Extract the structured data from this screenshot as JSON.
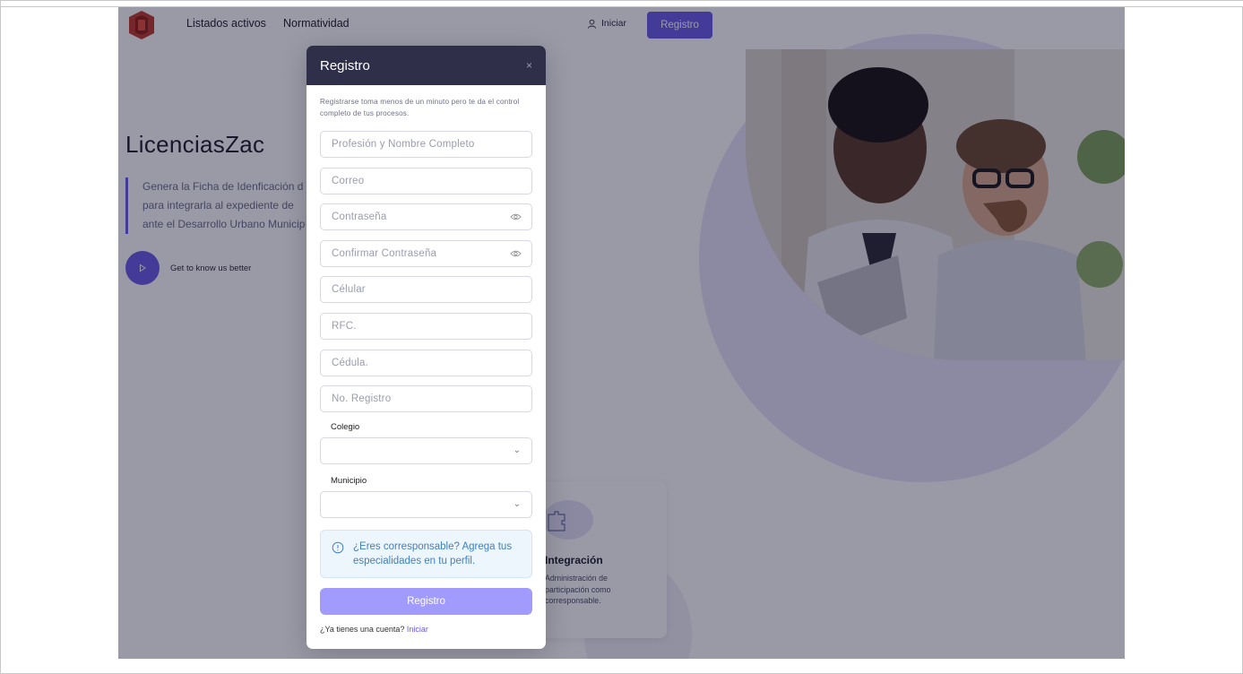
{
  "nav": {
    "links": [
      "Listados activos",
      "Normatividad"
    ],
    "login_label": "Iniciar",
    "register_label": "Registro",
    "accent": "#6c5ce7"
  },
  "hero": {
    "title": "LicenciasZac",
    "quote_lines": [
      "Genera la Ficha de Idenficación d",
      "para integrarla al expediente de",
      "ante el Desarrollo Urbano Municip"
    ],
    "play_label": "Get to know us better"
  },
  "card": {
    "title": "Integración",
    "text": "Administración de participación como corresponsable."
  },
  "modal": {
    "title": "Registro",
    "close": "×",
    "intro": "Registrarse toma menos de un minuto pero te da el control completo de tus procesos.",
    "fields": {
      "name": "Profesión y Nombre Completo",
      "email": "Correo",
      "password": "Contraseña",
      "confirm_password": "Confirmar Contraseña",
      "phone": "Célular",
      "rfc": "RFC.",
      "cedula": "Cédula.",
      "registro": "No. Registro"
    },
    "colegio_label": "Colegio",
    "municipio_label": "Municipio",
    "alert": "¿Eres corresponsable? Agrega tus especialidades en tu perfil.",
    "submit": "Registro",
    "footer_text": "¿Ya tienes una cuenta?",
    "footer_link": "Iniciar"
  },
  "icons": {
    "user": "user-icon",
    "play": "play-icon",
    "eye": "eye-icon",
    "info": "info-icon",
    "puzzle": "puzzle-icon",
    "logo": "logo-icon"
  }
}
